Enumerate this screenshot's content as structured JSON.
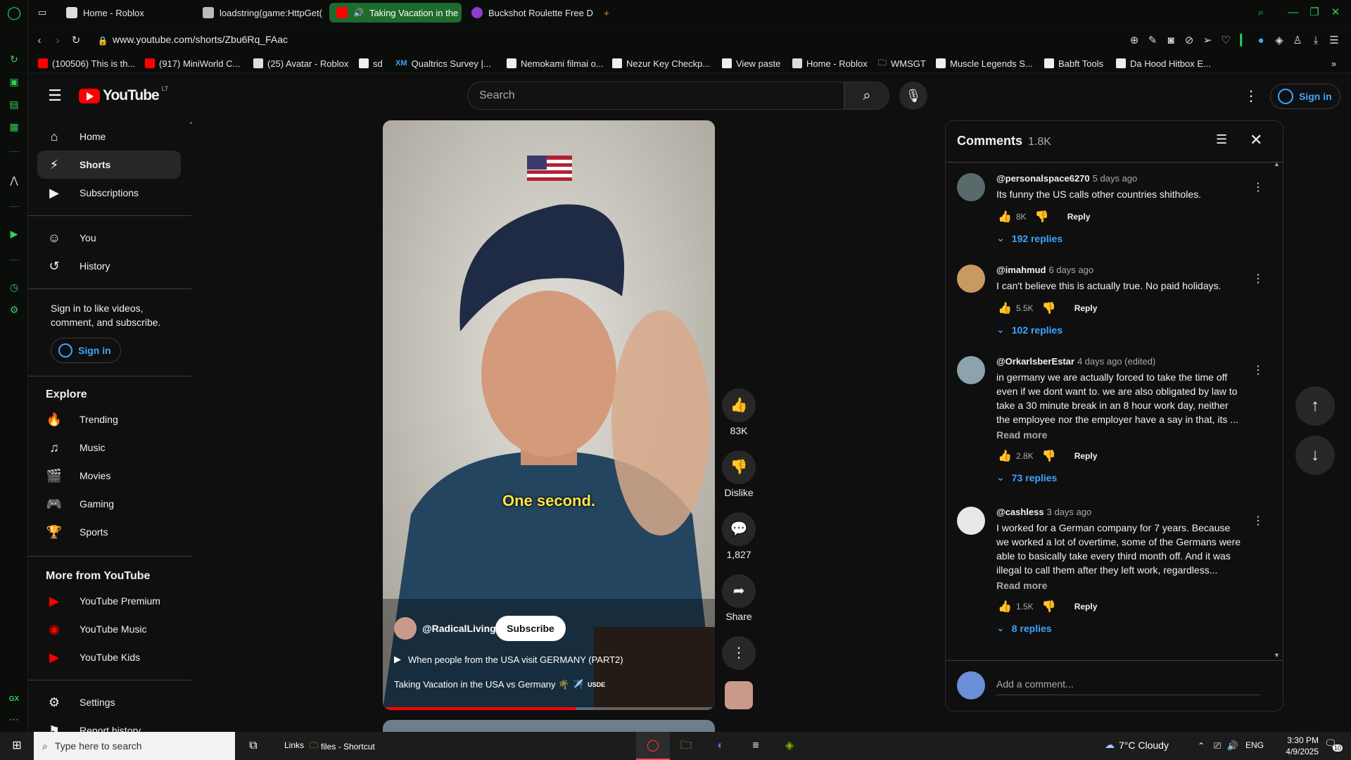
{
  "browser": {
    "tabs": [
      {
        "label": "Home - Roblox",
        "active": false
      },
      {
        "label": "loadstring(game:HttpGet(",
        "active": false
      },
      {
        "label": "Taking Vacation in the",
        "active": true
      },
      {
        "label": "Buckshot Roulette Free D",
        "active": false
      }
    ],
    "new_tab": "+",
    "url": "www.youtube.com/shorts/Zbu6Rq_FAac",
    "bookmarks": [
      "(100506) This is th...",
      "(917) MiniWorld C...",
      "(25) Avatar - Roblox",
      "sd",
      "Qualtrics Survey |...",
      "Nemokami filmai o...",
      "Nezur Key Checkp...",
      "View paste",
      "Home - Roblox",
      "WMSGT",
      "Muscle Legends S...",
      "Babft Tools",
      "Da Hood Hitbox E..."
    ],
    "bookmark_xm": "XM",
    "rail_gx": "GX"
  },
  "header": {
    "logo_text": "YouTube",
    "logo_region": "LT",
    "search_placeholder": "Search",
    "signin_label": "Sign in"
  },
  "sidebar": {
    "main_items": [
      "Home",
      "Shorts",
      "Subscriptions"
    ],
    "you_items": [
      "You",
      "History"
    ],
    "signin_prompt": "Sign in to like videos, comment, and subscribe.",
    "signin_button": "Sign in",
    "explore_heading": "Explore",
    "explore_items": [
      "Trending",
      "Music",
      "Movies",
      "Gaming",
      "Sports"
    ],
    "more_heading": "More from YouTube",
    "more_items": [
      "YouTube Premium",
      "YouTube Music",
      "YouTube Kids"
    ],
    "settings_items": [
      "Settings",
      "Report history"
    ]
  },
  "video": {
    "caption": "One second.",
    "channel": "@RadicalLiving",
    "subscribe": "Subscribe",
    "playlist": "When people from the USA visit GERMANY (PART2)",
    "title": "Taking Vacation in the USA vs Germany 🌴 ✈️",
    "title_tag": "USDE",
    "progress": 0.58
  },
  "actions": {
    "like_count": "83K",
    "dislike_label": "Dislike",
    "comment_count": "1,827",
    "share_label": "Share"
  },
  "comments": {
    "title": "Comments",
    "count": "1.8K",
    "add_placeholder": "Add a comment...",
    "reply_label": "Reply",
    "read_more": "Read more",
    "items": [
      {
        "author": "@personalspace6270",
        "time": "5 days ago",
        "text": "Its funny the US calls other countries shitholes.",
        "likes": "8K",
        "replies": "192 replies",
        "truncated": false
      },
      {
        "author": "@imahmud",
        "time": "6 days ago",
        "text": "I can't believe this is actually true. No paid holidays.",
        "likes": "5.5K",
        "replies": "102 replies",
        "truncated": false
      },
      {
        "author": "@OrkarlsberEstar",
        "time": "4 days ago (edited)",
        "text": "in germany we are actually forced to take the time off even if we dont want to. we are also obligated by law to take a 30 minute break in an 8 hour work day, neither the employee nor the employer have a say in that, its ...",
        "likes": "2.8K",
        "replies": "73 replies",
        "truncated": true
      },
      {
        "author": "@cashless",
        "time": "3 days ago",
        "text": "I worked for a German company for 7 years. Because we worked a lot of overtime, some of the Germans were able to basically take every third month off. And it was illegal to call them after they left work, regardless...",
        "likes": "1.5K",
        "replies": "8 replies",
        "truncated": true
      }
    ]
  },
  "taskbar": {
    "search_placeholder": "Type here to search",
    "links_label": "Links",
    "files_label": "files - Shortcut",
    "weather": "7°C  Cloudy",
    "lang": "ENG",
    "time": "3:30 PM",
    "date": "4/9/2025",
    "notif_count": "10"
  },
  "colors": {
    "opera_green": "#2fd158",
    "yt_red": "#ff0000",
    "link_blue": "#3ea6ff",
    "bg": "#0f0f0f"
  }
}
